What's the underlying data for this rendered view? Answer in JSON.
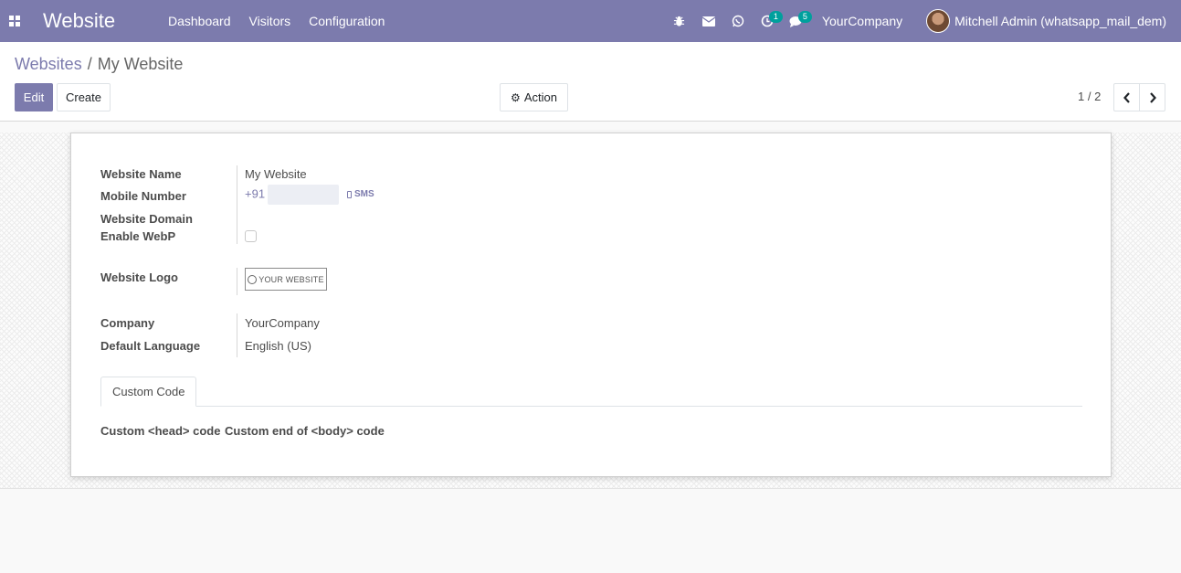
{
  "navbar": {
    "brand": "Website",
    "menu": [
      "Dashboard",
      "Visitors",
      "Configuration"
    ],
    "activity_badge": "1",
    "messages_badge": "5",
    "company": "YourCompany",
    "user": "Mitchell Admin (whatsapp_mail_dem)"
  },
  "control_panel": {
    "breadcrumb_parent": "Websites",
    "breadcrumb_separator": "/",
    "breadcrumb_current": "My Website",
    "edit_label": "Edit",
    "create_label": "Create",
    "action_label": "Action",
    "pager": "1 / 2"
  },
  "form": {
    "labels": {
      "website_name": "Website Name",
      "mobile_number": "Mobile Number",
      "website_domain": "Website Domain",
      "enable_webp": "Enable WebP",
      "website_logo": "Website Logo",
      "company": "Company",
      "default_language": "Default Language"
    },
    "values": {
      "website_name": "My Website",
      "mobile_prefix": "+91",
      "sms_label": "SMS",
      "logo_text": "YOUR WEBSITE",
      "company": "YourCompany",
      "default_language": "English (US)"
    },
    "enable_webp_checked": false,
    "tab": "Custom Code",
    "custom_head_label": "Custom <head> code",
    "custom_body_label": "Custom end of <body> code"
  },
  "colors": {
    "primary": "#7c7bad",
    "badge": "#00a09d"
  }
}
